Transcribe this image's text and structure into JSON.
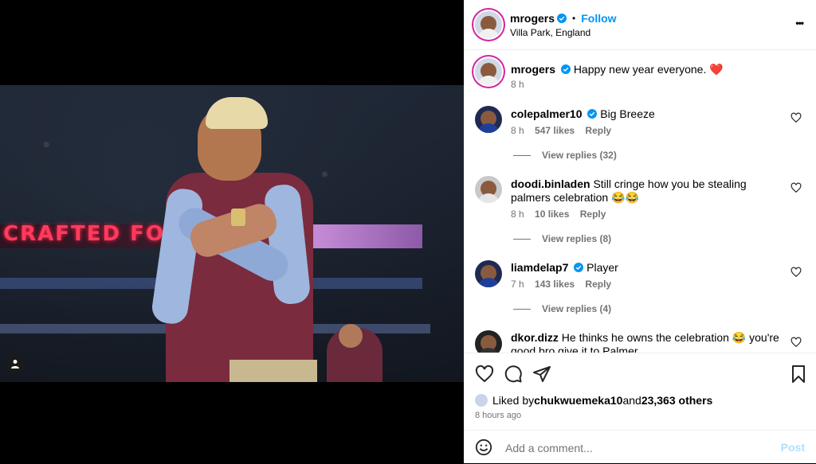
{
  "post": {
    "location": "Villa Park, England",
    "author": "mrogers",
    "follow_label": "Follow",
    "follow_sep": "•",
    "more_label": "•••",
    "caption_text": "Happy new year everyone. ❤️",
    "caption_time": "8 h",
    "photo_banner_text": "CRAFTED FOR"
  },
  "comments": [
    {
      "user": "colepalmer10",
      "verified": true,
      "text": "Big Breeze",
      "time": "8 h",
      "likes": "547 likes",
      "reply": "Reply",
      "view_replies": "View replies (32)"
    },
    {
      "user": "doodi.binladen",
      "verified": false,
      "text": "Still cringe how you be stealing palmers celebration 😂😂",
      "time": "8 h",
      "likes": "10 likes",
      "reply": "Reply",
      "view_replies": "View replies (8)"
    },
    {
      "user": "liamdelap7",
      "verified": true,
      "text": "Player",
      "time": "7 h",
      "likes": "143 likes",
      "reply": "Reply",
      "view_replies": "View replies (4)"
    },
    {
      "user": "dkor.dizz",
      "verified": false,
      "text": "He thinks he owns the celebration 😂 you're good bro give it to Palmer",
      "time": "",
      "likes": "",
      "reply": "",
      "view_replies": ""
    }
  ],
  "likes": {
    "prefix": "Liked by ",
    "user": "chukwuemeka10",
    "middle": " and ",
    "count": "23,363 others"
  },
  "time_ago": "8 hours ago",
  "add_comment": {
    "placeholder": "Add a comment...",
    "post_label": "Post"
  },
  "colors": {
    "accent": "#0095f6",
    "verified": "#0095f6",
    "muted": "#737373",
    "post_disabled": "#b2dffc"
  }
}
